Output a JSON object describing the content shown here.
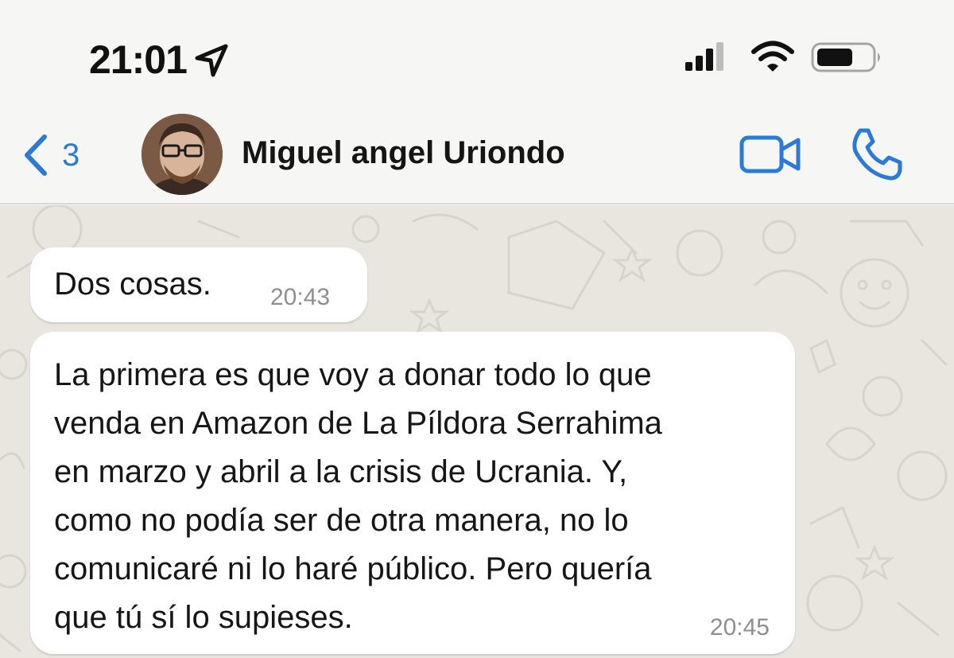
{
  "status_bar": {
    "time": "21:01",
    "location_icon": "location-arrow-icon",
    "signal_icon": "cellular-signal-icon",
    "wifi_icon": "wifi-icon",
    "battery_icon": "battery-icon"
  },
  "header": {
    "back_icon": "chevron-left-icon",
    "unread_count": "3",
    "contact_name": "Miguel angel Uriondo",
    "video_icon": "video-camera-icon",
    "phone_icon": "phone-icon"
  },
  "messages": [
    {
      "text": "Dos cosas.",
      "time": "20:43"
    },
    {
      "lines": [
        "La primera es que voy a donar todo lo que",
        "venda en Amazon de La Píldora Serrahima",
        "en marzo y abril a la crisis de Ucrania. Y,",
        "como no podía ser de otra manera, no lo",
        "comunicaré ni lo haré público. Pero quería",
        "que tú sí lo supieses."
      ],
      "time": "20:45"
    }
  ],
  "colors": {
    "accent": "#2a7ad6",
    "header_bg": "#f6f7f5",
    "chat_bg": "#e9e6e0",
    "bubble_bg": "#ffffff"
  }
}
